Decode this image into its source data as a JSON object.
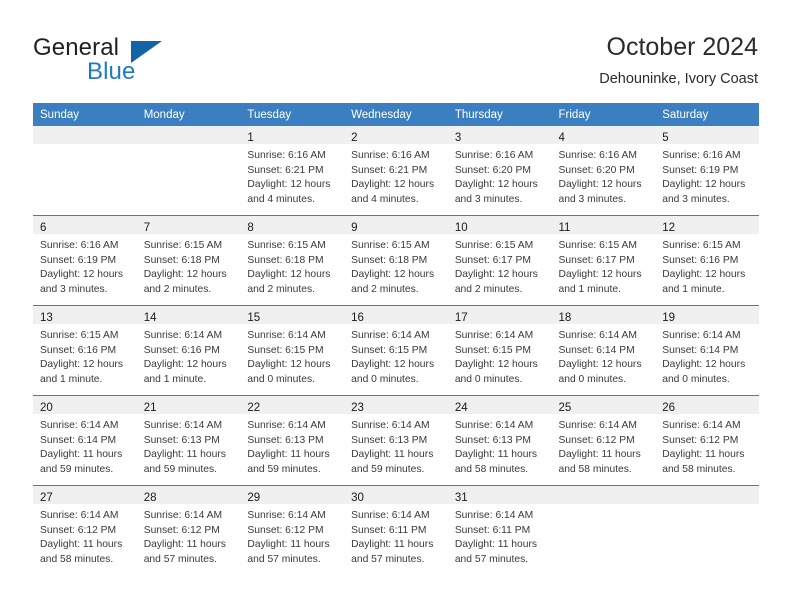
{
  "brand": {
    "name_part1": "General",
    "name_part2": "Blue",
    "flag_icon": "triangle-flag-icon"
  },
  "header": {
    "title": "October 2024",
    "subtitle": "Dehouninke, Ivory Coast"
  },
  "colors": {
    "header_blue": "#3c7fc0",
    "brand_blue": "#1f7ac4",
    "flag_blue": "#1464a5",
    "daynum_band": "#f0f0f0",
    "text": "#3a3a3a"
  },
  "weekday_headers": [
    "Sunday",
    "Monday",
    "Tuesday",
    "Wednesday",
    "Thursday",
    "Friday",
    "Saturday"
  ],
  "weeks": [
    [
      {
        "day": "",
        "lines": []
      },
      {
        "day": "",
        "lines": []
      },
      {
        "day": "1",
        "lines": [
          "Sunrise: 6:16 AM",
          "Sunset: 6:21 PM",
          "Daylight: 12 hours",
          "and 4 minutes."
        ]
      },
      {
        "day": "2",
        "lines": [
          "Sunrise: 6:16 AM",
          "Sunset: 6:21 PM",
          "Daylight: 12 hours",
          "and 4 minutes."
        ]
      },
      {
        "day": "3",
        "lines": [
          "Sunrise: 6:16 AM",
          "Sunset: 6:20 PM",
          "Daylight: 12 hours",
          "and 3 minutes."
        ]
      },
      {
        "day": "4",
        "lines": [
          "Sunrise: 6:16 AM",
          "Sunset: 6:20 PM",
          "Daylight: 12 hours",
          "and 3 minutes."
        ]
      },
      {
        "day": "5",
        "lines": [
          "Sunrise: 6:16 AM",
          "Sunset: 6:19 PM",
          "Daylight: 12 hours",
          "and 3 minutes."
        ]
      }
    ],
    [
      {
        "day": "6",
        "lines": [
          "Sunrise: 6:16 AM",
          "Sunset: 6:19 PM",
          "Daylight: 12 hours",
          "and 3 minutes."
        ]
      },
      {
        "day": "7",
        "lines": [
          "Sunrise: 6:15 AM",
          "Sunset: 6:18 PM",
          "Daylight: 12 hours",
          "and 2 minutes."
        ]
      },
      {
        "day": "8",
        "lines": [
          "Sunrise: 6:15 AM",
          "Sunset: 6:18 PM",
          "Daylight: 12 hours",
          "and 2 minutes."
        ]
      },
      {
        "day": "9",
        "lines": [
          "Sunrise: 6:15 AM",
          "Sunset: 6:18 PM",
          "Daylight: 12 hours",
          "and 2 minutes."
        ]
      },
      {
        "day": "10",
        "lines": [
          "Sunrise: 6:15 AM",
          "Sunset: 6:17 PM",
          "Daylight: 12 hours",
          "and 2 minutes."
        ]
      },
      {
        "day": "11",
        "lines": [
          "Sunrise: 6:15 AM",
          "Sunset: 6:17 PM",
          "Daylight: 12 hours",
          "and 1 minute."
        ]
      },
      {
        "day": "12",
        "lines": [
          "Sunrise: 6:15 AM",
          "Sunset: 6:16 PM",
          "Daylight: 12 hours",
          "and 1 minute."
        ]
      }
    ],
    [
      {
        "day": "13",
        "lines": [
          "Sunrise: 6:15 AM",
          "Sunset: 6:16 PM",
          "Daylight: 12 hours",
          "and 1 minute."
        ]
      },
      {
        "day": "14",
        "lines": [
          "Sunrise: 6:14 AM",
          "Sunset: 6:16 PM",
          "Daylight: 12 hours",
          "and 1 minute."
        ]
      },
      {
        "day": "15",
        "lines": [
          "Sunrise: 6:14 AM",
          "Sunset: 6:15 PM",
          "Daylight: 12 hours",
          "and 0 minutes."
        ]
      },
      {
        "day": "16",
        "lines": [
          "Sunrise: 6:14 AM",
          "Sunset: 6:15 PM",
          "Daylight: 12 hours",
          "and 0 minutes."
        ]
      },
      {
        "day": "17",
        "lines": [
          "Sunrise: 6:14 AM",
          "Sunset: 6:15 PM",
          "Daylight: 12 hours",
          "and 0 minutes."
        ]
      },
      {
        "day": "18",
        "lines": [
          "Sunrise: 6:14 AM",
          "Sunset: 6:14 PM",
          "Daylight: 12 hours",
          "and 0 minutes."
        ]
      },
      {
        "day": "19",
        "lines": [
          "Sunrise: 6:14 AM",
          "Sunset: 6:14 PM",
          "Daylight: 12 hours",
          "and 0 minutes."
        ]
      }
    ],
    [
      {
        "day": "20",
        "lines": [
          "Sunrise: 6:14 AM",
          "Sunset: 6:14 PM",
          "Daylight: 11 hours",
          "and 59 minutes."
        ]
      },
      {
        "day": "21",
        "lines": [
          "Sunrise: 6:14 AM",
          "Sunset: 6:13 PM",
          "Daylight: 11 hours",
          "and 59 minutes."
        ]
      },
      {
        "day": "22",
        "lines": [
          "Sunrise: 6:14 AM",
          "Sunset: 6:13 PM",
          "Daylight: 11 hours",
          "and 59 minutes."
        ]
      },
      {
        "day": "23",
        "lines": [
          "Sunrise: 6:14 AM",
          "Sunset: 6:13 PM",
          "Daylight: 11 hours",
          "and 59 minutes."
        ]
      },
      {
        "day": "24",
        "lines": [
          "Sunrise: 6:14 AM",
          "Sunset: 6:13 PM",
          "Daylight: 11 hours",
          "and 58 minutes."
        ]
      },
      {
        "day": "25",
        "lines": [
          "Sunrise: 6:14 AM",
          "Sunset: 6:12 PM",
          "Daylight: 11 hours",
          "and 58 minutes."
        ]
      },
      {
        "day": "26",
        "lines": [
          "Sunrise: 6:14 AM",
          "Sunset: 6:12 PM",
          "Daylight: 11 hours",
          "and 58 minutes."
        ]
      }
    ],
    [
      {
        "day": "27",
        "lines": [
          "Sunrise: 6:14 AM",
          "Sunset: 6:12 PM",
          "Daylight: 11 hours",
          "and 58 minutes."
        ]
      },
      {
        "day": "28",
        "lines": [
          "Sunrise: 6:14 AM",
          "Sunset: 6:12 PM",
          "Daylight: 11 hours",
          "and 57 minutes."
        ]
      },
      {
        "day": "29",
        "lines": [
          "Sunrise: 6:14 AM",
          "Sunset: 6:12 PM",
          "Daylight: 11 hours",
          "and 57 minutes."
        ]
      },
      {
        "day": "30",
        "lines": [
          "Sunrise: 6:14 AM",
          "Sunset: 6:11 PM",
          "Daylight: 11 hours",
          "and 57 minutes."
        ]
      },
      {
        "day": "31",
        "lines": [
          "Sunrise: 6:14 AM",
          "Sunset: 6:11 PM",
          "Daylight: 11 hours",
          "and 57 minutes."
        ]
      },
      {
        "day": "",
        "lines": []
      },
      {
        "day": "",
        "lines": []
      }
    ]
  ]
}
